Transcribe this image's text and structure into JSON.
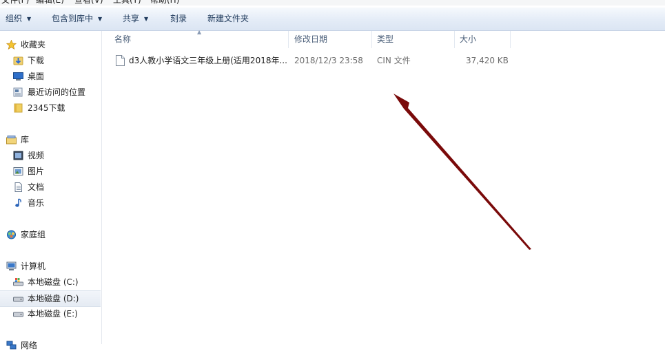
{
  "menubar": {
    "items": [
      "文件(F)",
      "编辑(E)",
      "查看(V)",
      "工具(T)",
      "帮助(H)"
    ]
  },
  "toolbar": {
    "organize": "组织",
    "include_library": "包含到库中",
    "share": "共享",
    "burn": "刻录",
    "new_folder": "新建文件夹"
  },
  "nav": {
    "favorites": {
      "label": "收藏夹",
      "items": [
        "下载",
        "桌面",
        "最近访问的位置",
        "2345下载"
      ]
    },
    "libraries": {
      "label": "库",
      "items": [
        "视频",
        "图片",
        "文档",
        "音乐"
      ]
    },
    "homegroup": {
      "label": "家庭组"
    },
    "computer": {
      "label": "计算机",
      "items": [
        "本地磁盘 (C:)",
        "本地磁盘 (D:)",
        "本地磁盘 (E:)"
      ]
    },
    "network": {
      "label": "网络"
    }
  },
  "columns": {
    "name": "名称",
    "modified": "修改日期",
    "type": "类型",
    "size": "大小"
  },
  "files": [
    {
      "name": "d3人教小学语文三年级上册(适用2018年...",
      "modified": "2018/12/3 23:58",
      "type": "CIN 文件",
      "size": "37,420 KB"
    }
  ],
  "colors": {
    "annotation_arrow": "#7a0a0a",
    "toolbar_text": "#1e395b",
    "header_text": "#4c607a"
  }
}
